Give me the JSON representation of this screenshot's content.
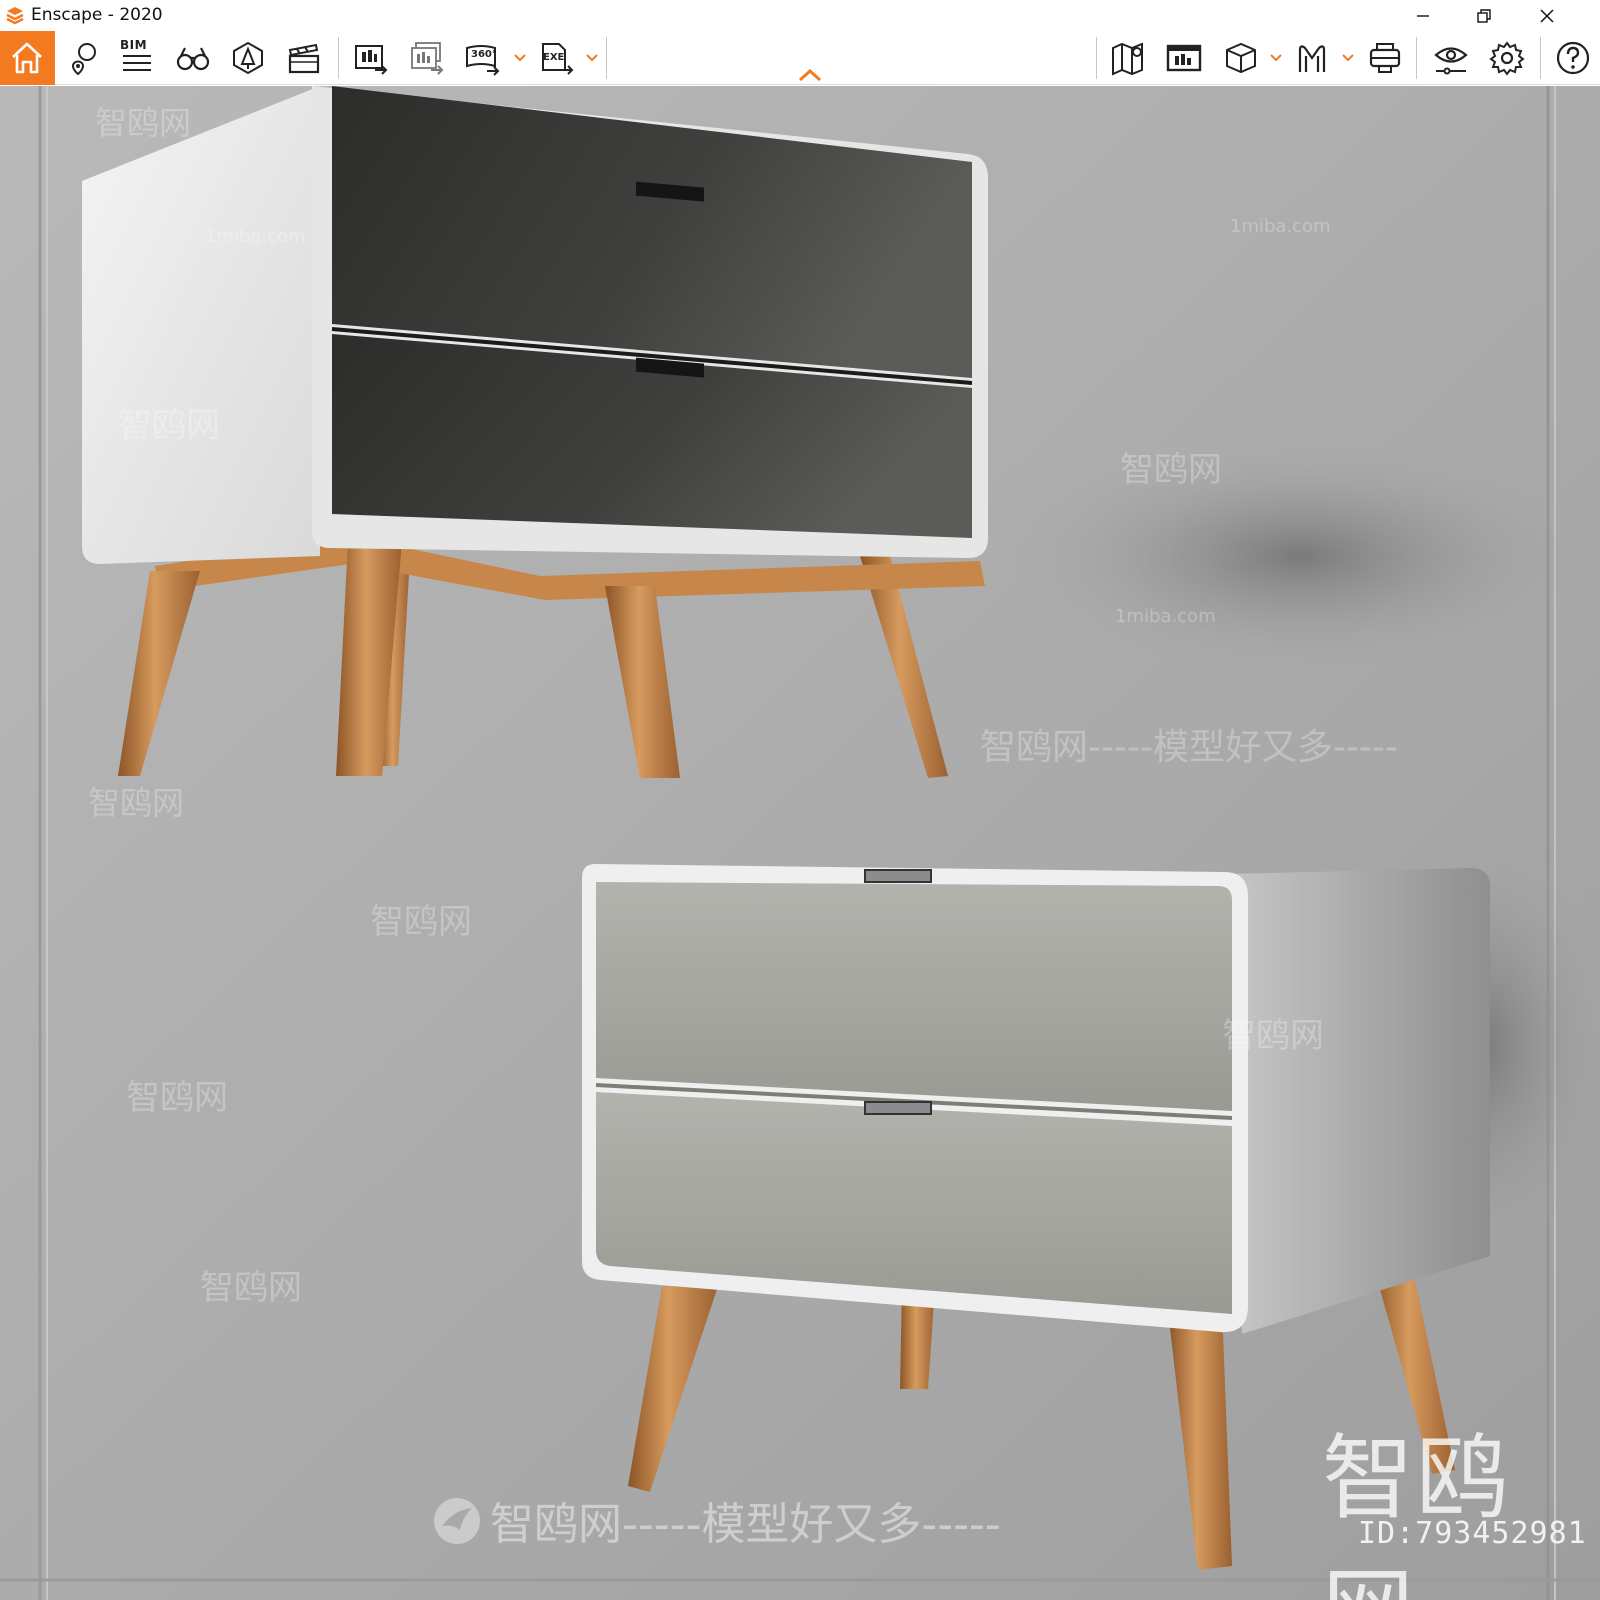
{
  "window": {
    "title": "Enscape - 2020",
    "minimize_icon": "minimize-icon",
    "maximize_icon": "restore-icon",
    "close_icon": "close-icon"
  },
  "toolbar": {
    "bim_label": "BIM",
    "left_tools": [
      "home-icon",
      "views-icon",
      "bim-icon",
      "binoculars-icon",
      "asset-library-icon",
      "video-editor-icon"
    ],
    "export_tools": [
      "screenshot-export-icon",
      "batch-render-icon",
      "360-panorama-icon",
      "exe-export-icon"
    ],
    "panorama_label": "360°",
    "exe_label": "EXE",
    "right_tools": [
      "map-icon",
      "minimap-icon",
      "object-mode-icon",
      "vr-headset-icon",
      "capture-icon",
      "visual-settings-icon",
      "settings-icon",
      "help-icon"
    ],
    "accent_color": "#f47a20"
  },
  "viewport": {
    "watermarks": [
      "智鸥网",
      "1miba.com",
      "智鸥网-----模型好又多-----",
      "智鸥网",
      "ID:793452981"
    ],
    "background_color": "#a9a9a9"
  }
}
